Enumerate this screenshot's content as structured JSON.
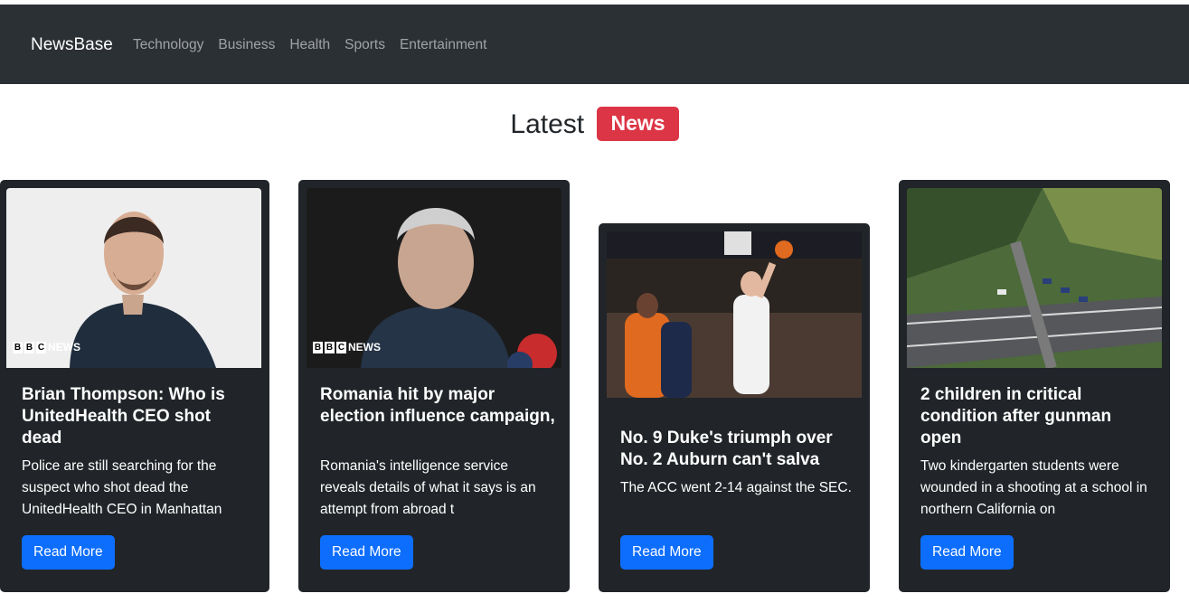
{
  "nav": {
    "brand": "NewsBase",
    "links": [
      "Technology",
      "Business",
      "Health",
      "Sports",
      "Entertainment"
    ]
  },
  "heading": {
    "text": "Latest",
    "badge": "News"
  },
  "cards": [
    {
      "title": "Brian Thompson: Who is UnitedHealth CEO shot dead",
      "description": "Police are still searching for the suspect who shot dead the UnitedHealth CEO in Manhattan",
      "button": "Read More",
      "image_icon": "news-photo-portrait",
      "watermark": "NEWS"
    },
    {
      "title": "Romania hit by major election influence campaign,",
      "description": "Romania's intelligence service reveals details of what it says is an attempt from abroad t",
      "button": "Read More",
      "image_icon": "news-photo-portrait",
      "watermark": "NEWS"
    },
    {
      "title": "No. 9 Duke's triumph over No. 2 Auburn can't salva",
      "description": "The ACC went 2-14 against the SEC.",
      "button": "Read More",
      "image_icon": "basketball-photo"
    },
    {
      "title": "2 children in critical condition after gunman open",
      "description": "Two kindergarten students were wounded in a shooting at a school in northern California on",
      "button": "Read More",
      "image_icon": "aerial-photo"
    }
  ],
  "colors": {
    "navbar": "#2b3035",
    "card": "#212529",
    "badge": "#dc3545",
    "button": "#0d6efd"
  }
}
